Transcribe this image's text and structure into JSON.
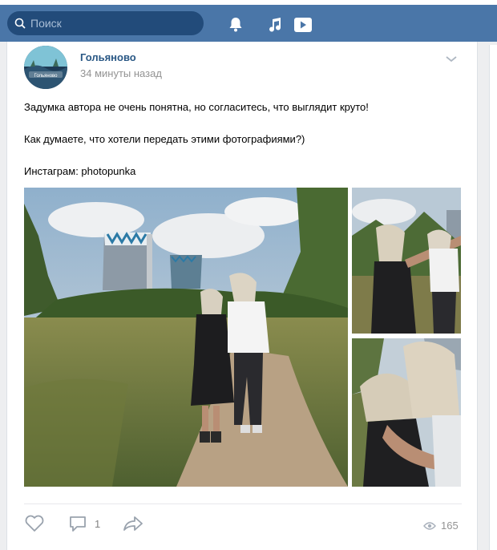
{
  "header": {
    "search_placeholder": "Поиск",
    "accent_color": "#4a76a8"
  },
  "post": {
    "group_name": "Гольяново",
    "time": "34 минуты назад",
    "avatar_text": "Гольяново",
    "lines": [
      "Задумка автора не очень понятна, но согласитесь, что выглядит круто!",
      "Как думаете, что хотели передать этими фотографиями?)",
      "Инстаграм: photopunka"
    ],
    "comments_count": "1",
    "views_count": "165"
  },
  "icons": [
    "search-icon",
    "bell-icon",
    "music-icon",
    "video-icon",
    "chevron-down-icon",
    "like-icon",
    "comment-icon",
    "share-icon",
    "eye-icon"
  ]
}
